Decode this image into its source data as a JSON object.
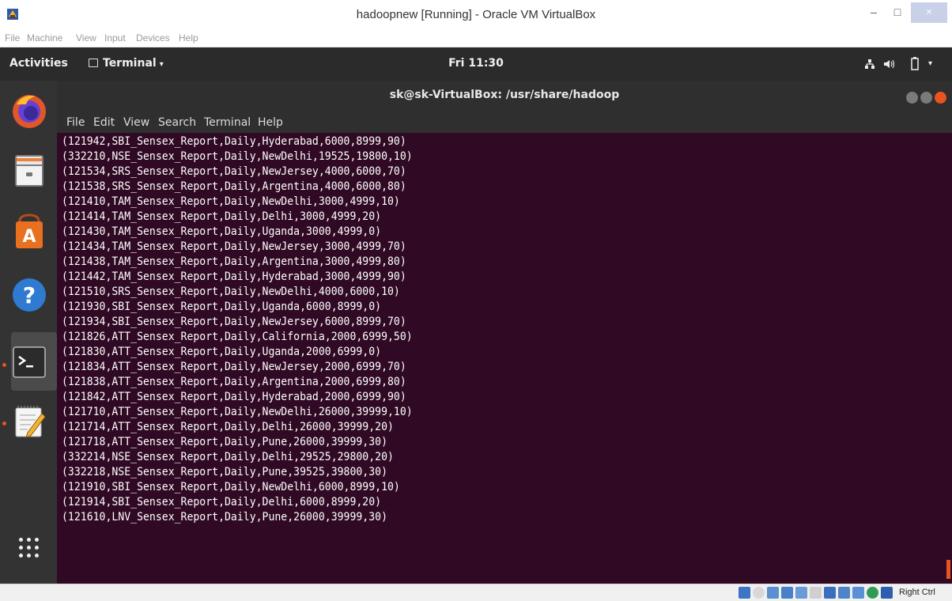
{
  "vbox": {
    "title": "hadoopnew [Running] - Oracle VM VirtualBox",
    "controls": {
      "minimize": "–",
      "maximize": "□",
      "close": "×"
    },
    "menu": [
      "File",
      "Machine",
      "View",
      "Input",
      "Devices",
      "Help"
    ],
    "host_key": "Right Ctrl"
  },
  "topbar": {
    "activities": "Activities",
    "app_menu": "Terminal",
    "caret": "▾",
    "clock": "Fri 11:30",
    "status_icons": [
      "network-icon",
      "volume-icon",
      "battery-icon",
      "system-menu-icon"
    ]
  },
  "dock": {
    "items": [
      "firefox-icon",
      "files-icon",
      "software-center-icon",
      "help-icon",
      "terminal-icon",
      "text-editor-icon"
    ],
    "show_apps": "show-applications-icon"
  },
  "terminal": {
    "title": "sk@sk-VirtualBox: /usr/share/hadoop",
    "menu": [
      "File",
      "Edit",
      "View",
      "Search",
      "Terminal",
      "Help"
    ],
    "lines": [
      "(121942,SBI_Sensex_Report,Daily,Hyderabad,6000,8999,90)",
      "(332210,NSE_Sensex_Report,Daily,NewDelhi,19525,19800,10)",
      "(121534,SRS_Sensex_Report,Daily,NewJersey,4000,6000,70)",
      "(121538,SRS_Sensex_Report,Daily,Argentina,4000,6000,80)",
      "(121410,TAM_Sensex_Report,Daily,NewDelhi,3000,4999,10)",
      "(121414,TAM_Sensex_Report,Daily,Delhi,3000,4999,20)",
      "(121430,TAM_Sensex_Report,Daily,Uganda,3000,4999,0)",
      "(121434,TAM_Sensex_Report,Daily,NewJersey,3000,4999,70)",
      "(121438,TAM_Sensex_Report,Daily,Argentina,3000,4999,80)",
      "(121442,TAM_Sensex_Report,Daily,Hyderabad,3000,4999,90)",
      "(121510,SRS_Sensex_Report,Daily,NewDelhi,4000,6000,10)",
      "(121930,SBI_Sensex_Report,Daily,Uganda,6000,8999,0)",
      "(121934,SBI_Sensex_Report,Daily,NewJersey,6000,8999,70)",
      "(121826,ATT_Sensex_Report,Daily,California,2000,6999,50)",
      "(121830,ATT_Sensex_Report,Daily,Uganda,2000,6999,0)",
      "(121834,ATT_Sensex_Report,Daily,NewJersey,2000,6999,70)",
      "(121838,ATT_Sensex_Report,Daily,Argentina,2000,6999,80)",
      "(121842,ATT_Sensex_Report,Daily,Hyderabad,2000,6999,90)",
      "(121710,ATT_Sensex_Report,Daily,NewDelhi,26000,39999,10)",
      "(121714,ATT_Sensex_Report,Daily,Delhi,26000,39999,20)",
      "(121718,ATT_Sensex_Report,Daily,Pune,26000,39999,30)",
      "(332214,NSE_Sensex_Report,Daily,Delhi,29525,29800,20)",
      "(332218,NSE_Sensex_Report,Daily,Pune,39525,39800,30)",
      "(121910,SBI_Sensex_Report,Daily,NewDelhi,6000,8999,10)",
      "(121914,SBI_Sensex_Report,Daily,Delhi,6000,8999,20)",
      "(121610,LNV_Sensex_Report,Daily,Pune,26000,39999,30)"
    ]
  },
  "colors": {
    "terminal_bg": "#300a24",
    "ubuntu_orange": "#e95420",
    "topbar_bg": "#2b2b2b",
    "dock_bg": "#333333"
  }
}
